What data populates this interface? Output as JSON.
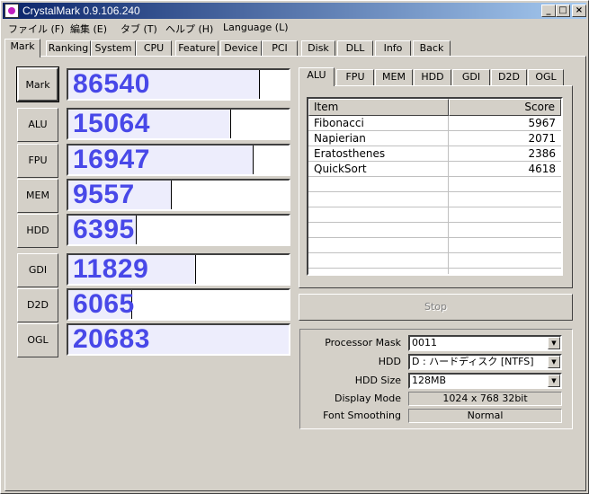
{
  "window": {
    "title": "CrystalMark 0.9.106.240"
  },
  "controls": {
    "minimize": "_",
    "maximize": "□",
    "close": "×"
  },
  "menu": [
    "ファイル (F)",
    "編集 (E)",
    "タブ (T)",
    "ヘルプ (H)",
    "Language (L)"
  ],
  "tabs": [
    "Mark",
    "Ranking",
    "System",
    "CPU",
    "Feature",
    "Device",
    "PCI",
    "Disk",
    "DLL",
    "Info",
    "Back"
  ],
  "scores": [
    {
      "label": "Mark",
      "value": "86540",
      "fill": 0.87
    },
    {
      "label": "ALU",
      "value": "15064",
      "fill": 0.74
    },
    {
      "label": "FPU",
      "value": "16947",
      "fill": 0.84
    },
    {
      "label": "MEM",
      "value": "9557",
      "fill": 0.47
    },
    {
      "label": "HDD",
      "value": "6395",
      "fill": 0.31
    },
    {
      "label": "GDI",
      "value": "11829",
      "fill": 0.58
    },
    {
      "label": "D2D",
      "value": "6065",
      "fill": 0.29
    },
    {
      "label": "OGL",
      "value": "20683",
      "fill": 1.0
    }
  ],
  "subtabs": [
    "ALU",
    "FPU",
    "MEM",
    "HDD",
    "GDI",
    "D2D",
    "OGL"
  ],
  "table": {
    "columns": [
      "Item",
      "Score"
    ],
    "rows": [
      [
        "Fibonacci",
        "5967"
      ],
      [
        "Napierian",
        "2071"
      ],
      [
        "Eratosthenes",
        "2386"
      ],
      [
        "QuickSort",
        "4618"
      ]
    ]
  },
  "stop_label": "Stop",
  "config": {
    "processor_mask": {
      "label": "Processor Mask",
      "value": "0011"
    },
    "hdd": {
      "label": "HDD",
      "value": "D : ハードディスク [NTFS]"
    },
    "hdd_size": {
      "label": "HDD Size",
      "value": "128MB"
    },
    "display_mode": {
      "label": "Display Mode",
      "value": "1024 x 768 32bit"
    },
    "font_smoothing": {
      "label": "Font Smoothing",
      "value": "Normal"
    }
  }
}
